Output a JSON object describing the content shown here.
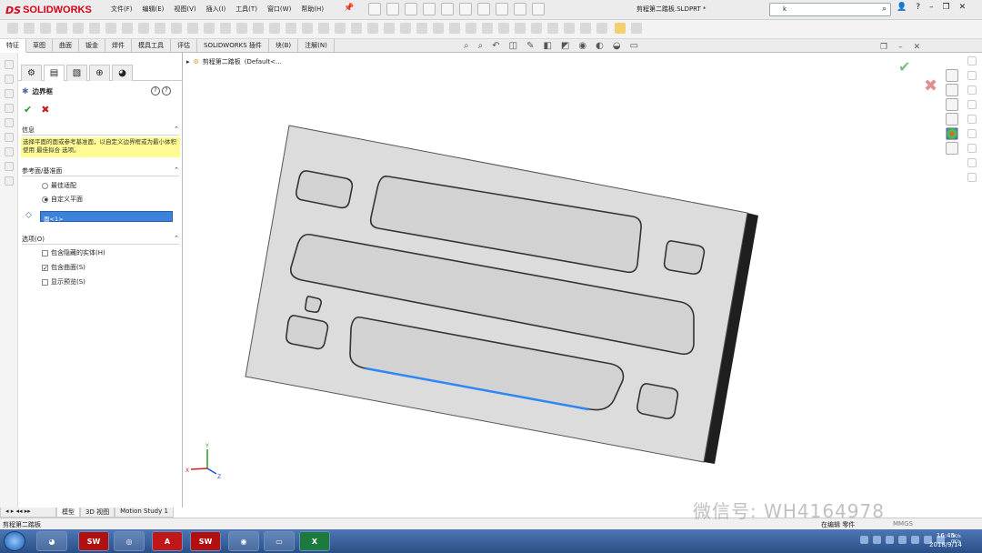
{
  "app": {
    "logo_ds": "DS",
    "logo_name": "SOLIDWORKS",
    "doc_title": "剪程第二踏板.SLDPRT *",
    "search_value": "k"
  },
  "menus": [
    "文件(F)",
    "编辑(E)",
    "视图(V)",
    "插入(I)",
    "工具(T)",
    "窗口(W)",
    "帮助(H)"
  ],
  "tabs": [
    "特征",
    "草图",
    "曲面",
    "钣金",
    "焊件",
    "模具工具",
    "评估",
    "SOLIDWORKS 插件",
    "块(B)",
    "注解(N)"
  ],
  "active_tab": 0,
  "pm": {
    "title": "边界框",
    "help1": "?",
    "help2": "?",
    "ok": "✔",
    "cancel": "✖",
    "info_header": "信息",
    "info_text": "选择平面的面或参考基准面，以自定义边界框或为最小体积使用 最佳拟合 选项。",
    "ref_header": "参考面/基准面",
    "radio_best": "最佳适配",
    "radio_custom": "自定义平面",
    "face_value": "面<1>",
    "options_header": "选项(O)",
    "check_hidden": "包含隐藏的实体(H)",
    "check_surface": "包含曲面(S)",
    "check_preview": "显示预览(S)"
  },
  "tree": {
    "part": "剪程第二踏板",
    "config": "(Default<..."
  },
  "bottom_tabs": [
    "模型",
    "3D 视图",
    "Motion Study 1"
  ],
  "status": {
    "left": "剪程第二踏板",
    "right": "在编辑 零件",
    "mmgs": "MMGS"
  },
  "taskbar": {
    "sw1": "SW",
    "a": "A",
    "sw2": "SW",
    "time": "16:45",
    "date": "2018/9/14",
    "net1": "0K/s",
    "net2": "0K/s"
  },
  "watermark": "微信号: WH4164978",
  "colors": {
    "accent": "#3d82d9",
    "highlight_edge": "#2f86f6",
    "info_bg": "#fffb92",
    "part_face": "#dcdcdc"
  }
}
